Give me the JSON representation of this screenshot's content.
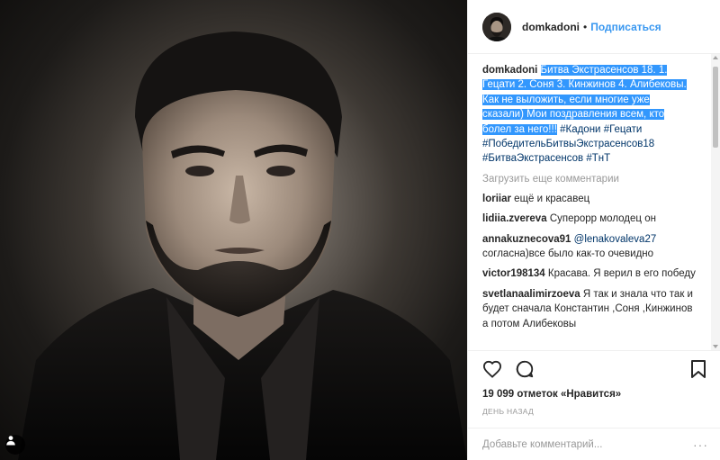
{
  "header": {
    "username": "domkadoni",
    "separator": "•",
    "follow_label": "Подписаться"
  },
  "caption": {
    "username": "domkadoni",
    "selected_text": "Битва Экстрасенсов 18. 1. Гецати 2. Соня 3. Кинжинов 4. Алибековы. Как не выложить, если многие уже сказали) Мои поздравления всем, кто болел за него!!!",
    "hashtags": [
      "#Кадони",
      "#Гецати",
      "#ПобедительБитвыЭкстрасенсов18",
      "#БитваЭкстрасенсов",
      "#ТнТ"
    ]
  },
  "load_more_label": "Загрузить еще комментарии",
  "comments": [
    {
      "user": "loriiar",
      "text": "ещё и красавец"
    },
    {
      "user": "lidiia.zvereva",
      "text": "Суперорр молодец он"
    },
    {
      "user": "annakuznecova91",
      "mention": "@lenakovaleva27",
      "text": "согласна)все было как-то очевидно"
    },
    {
      "user": "victor198134",
      "text": "Красава. Я верил в его победу"
    },
    {
      "user": "svetlanaalimirzoeva",
      "text": "Я так и знала что так и будет сначала Константин ,Соня ,Кинжинов а потом Алибековы"
    }
  ],
  "likes": "19 099 отметок «Нравится»",
  "time": "ДЕНЬ НАЗАД",
  "add_comment_placeholder": "Добавьте комментарий...",
  "more_options": "···",
  "icons": {
    "like": "heart-icon",
    "comment": "comment-icon",
    "save": "bookmark-icon",
    "tagged": "user-tag-icon"
  },
  "colors": {
    "link": "#3897f0",
    "hashtag": "#003569",
    "selection": "#3297fd",
    "muted": "#999999"
  }
}
